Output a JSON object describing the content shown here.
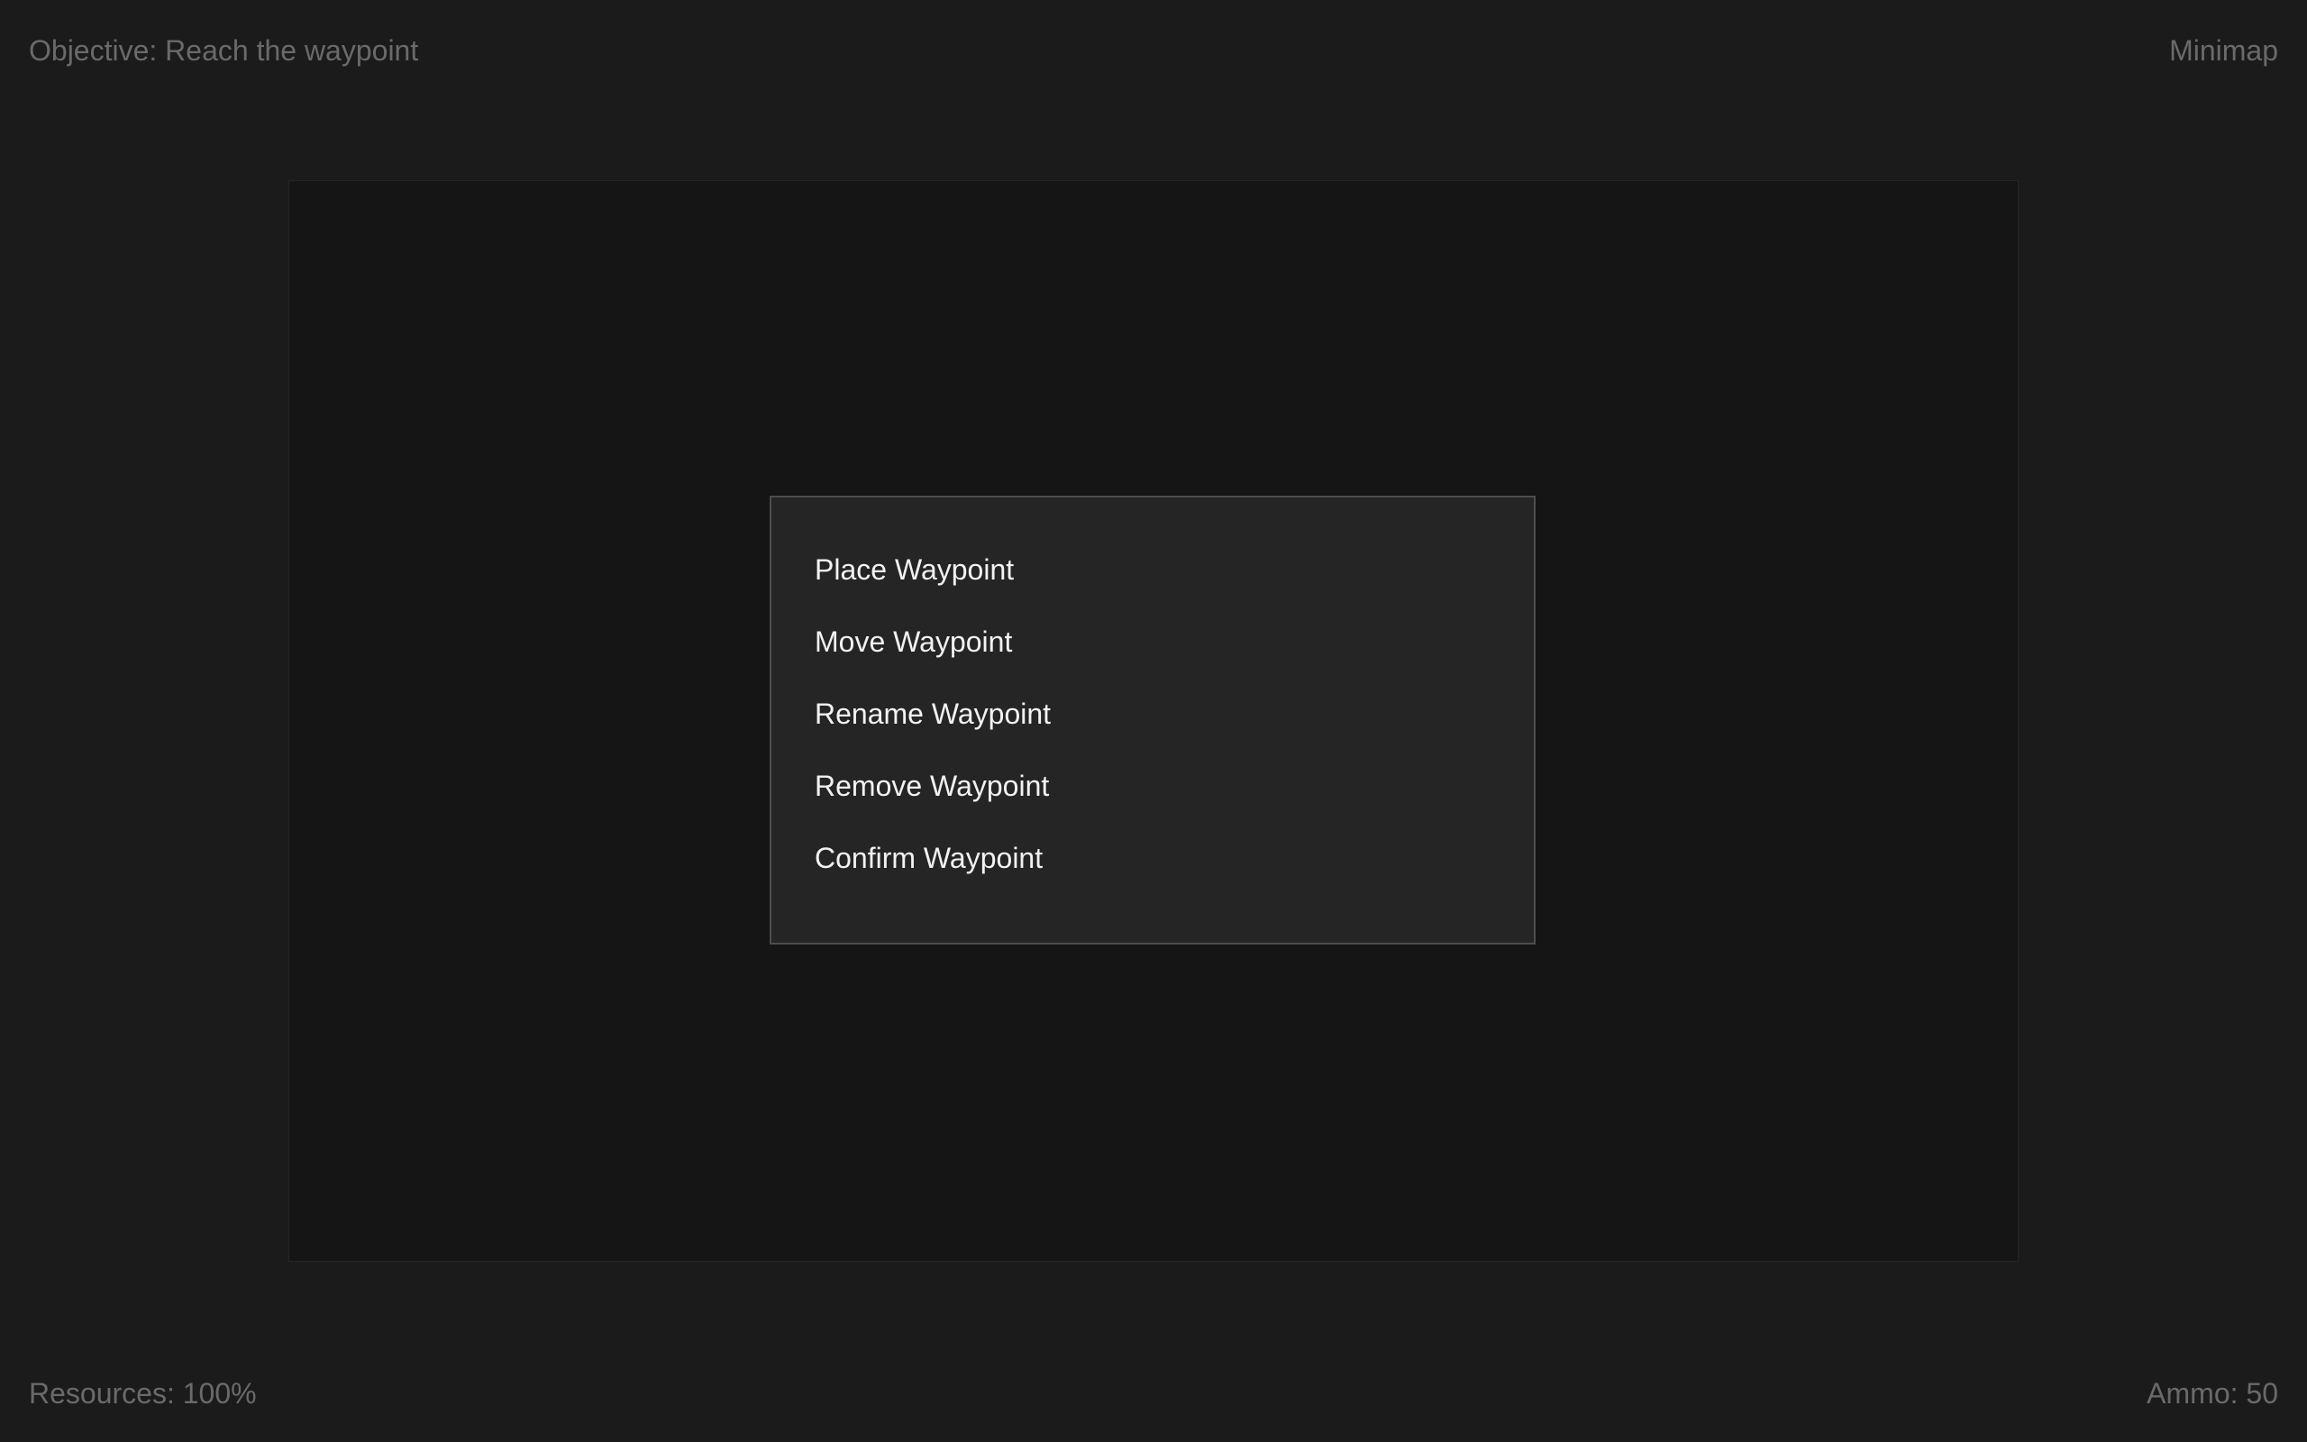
{
  "hud": {
    "objective": "Objective: Reach the waypoint",
    "minimap_label": "Minimap",
    "resources": "Resources: 100%",
    "ammo": "Ammo: 50"
  },
  "waypoint_menu": {
    "items": [
      {
        "label": "Place Waypoint"
      },
      {
        "label": "Move Waypoint"
      },
      {
        "label": "Rename Waypoint"
      },
      {
        "label": "Remove Waypoint"
      },
      {
        "label": "Confirm Waypoint"
      }
    ]
  },
  "colors": {
    "background": "#1b1b1b",
    "viewport": "#151515",
    "menu_background": "#252525",
    "menu_border": "#4d4d4d",
    "hud_text": "#6a6a6a",
    "menu_text": "#f2f2f2"
  }
}
